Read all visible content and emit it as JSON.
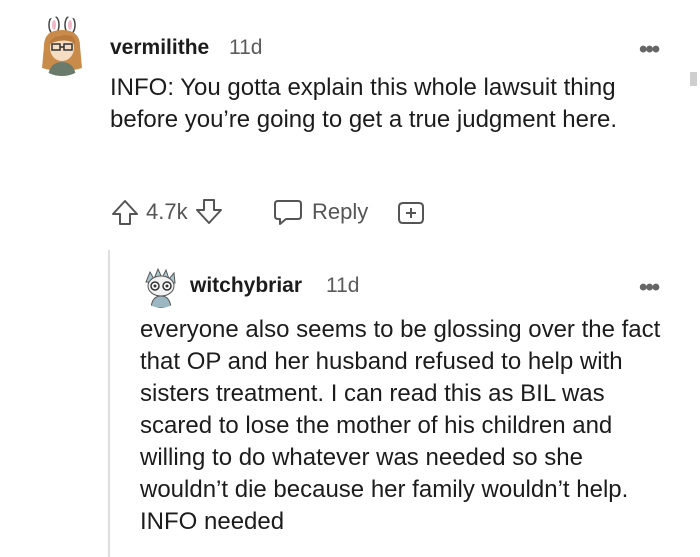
{
  "comment": {
    "username": "vermilithe",
    "time": "11d",
    "text": "INFO: You gotta explain this whole lawsuit thing before you’re going to get a true judgment here.",
    "votes": "4.7k",
    "reply_label": "Reply"
  },
  "reply": {
    "username": "witchybriar",
    "time": "11d",
    "text": "everyone also seems to be glossing over the fact that OP and her husband refused to help with sisters treatment. I can read this as BIL was scared to lose the mother of his children and willing to do whatever was needed so she wouldn’t die because her family wouldn’t help. INFO needed"
  },
  "icons": {
    "upvote": "arrow-up-icon",
    "downvote": "arrow-down-icon",
    "reply": "speech-bubble-icon",
    "award": "plus-circle-icon",
    "more": "more-options-icon"
  },
  "colors": {
    "text": "#1c1c1c",
    "muted": "#5b5b5b",
    "thread_line": "#dedede"
  }
}
